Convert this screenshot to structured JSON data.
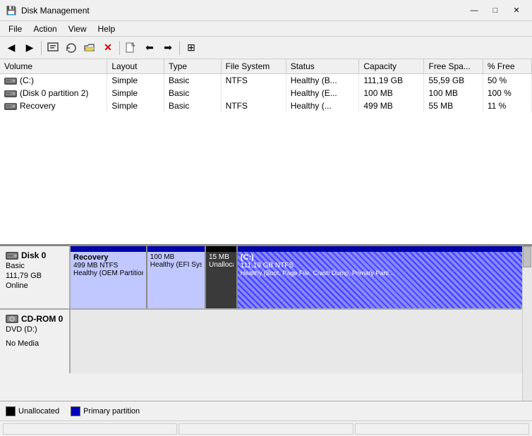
{
  "window": {
    "title": "Disk Management",
    "icon": "💾"
  },
  "titlebar": {
    "minimize": "—",
    "maximize": "□",
    "close": "✕"
  },
  "menu": {
    "items": [
      "File",
      "Action",
      "View",
      "Help"
    ]
  },
  "toolbar": {
    "buttons": [
      "◀",
      "▶",
      "📋",
      "🔧",
      "📂",
      "✕",
      "📄",
      "⬅",
      "➡",
      "⊞"
    ]
  },
  "table": {
    "columns": [
      "Volume",
      "Layout",
      "Type",
      "File System",
      "Status",
      "Capacity",
      "Free Spa...",
      "% Free"
    ],
    "rows": [
      {
        "volume": "(C:)",
        "layout": "Simple",
        "type": "Basic",
        "filesystem": "NTFS",
        "status": "Healthy (B...",
        "capacity": "111,19 GB",
        "free_space": "55,59 GB",
        "percent_free": "50 %",
        "icon": "hdd"
      },
      {
        "volume": "(Disk 0 partition 2)",
        "layout": "Simple",
        "type": "Basic",
        "filesystem": "",
        "status": "Healthy (E...",
        "capacity": "100 MB",
        "free_space": "100 MB",
        "percent_free": "100 %",
        "icon": "hdd"
      },
      {
        "volume": "Recovery",
        "layout": "Simple",
        "type": "Basic",
        "filesystem": "NTFS",
        "status": "Healthy (...",
        "capacity": "499 MB",
        "free_space": "55 MB",
        "percent_free": "11 %",
        "icon": "hdd"
      }
    ]
  },
  "disks": [
    {
      "name": "Disk 0",
      "type": "Basic",
      "size": "111,79 GB",
      "status": "Online",
      "partitions": [
        {
          "name": "Recovery",
          "size": "499 MB NTFS",
          "status": "Healthy (OEM Partition)",
          "width_pct": 17,
          "header_color": "blue",
          "bg": "blue"
        },
        {
          "name": "",
          "size": "100 MB",
          "status": "Healthy (EFI Syster",
          "width_pct": 15,
          "header_color": "blue",
          "bg": "blue"
        },
        {
          "name": "",
          "size": "15 MB",
          "status": "Unallocati",
          "width_pct": 8,
          "header_color": "black",
          "bg": "black_fill"
        },
        {
          "name": "(C:)",
          "size": "111,19 GB NTFS",
          "status": "Healthy (Boot, Page File, Crash Dump, Primary Parti...",
          "width_pct": 60,
          "header_color": "blue",
          "bg": "hatch"
        }
      ]
    }
  ],
  "cdrom": {
    "name": "CD-ROM 0",
    "type": "DVD (D:)",
    "status": "No Media"
  },
  "legend": [
    {
      "label": "Unallocated",
      "color": "#000000"
    },
    {
      "label": "Primary partition",
      "color": "#0000bb"
    }
  ],
  "statusbar": {
    "segments": [
      "",
      "",
      ""
    ]
  }
}
